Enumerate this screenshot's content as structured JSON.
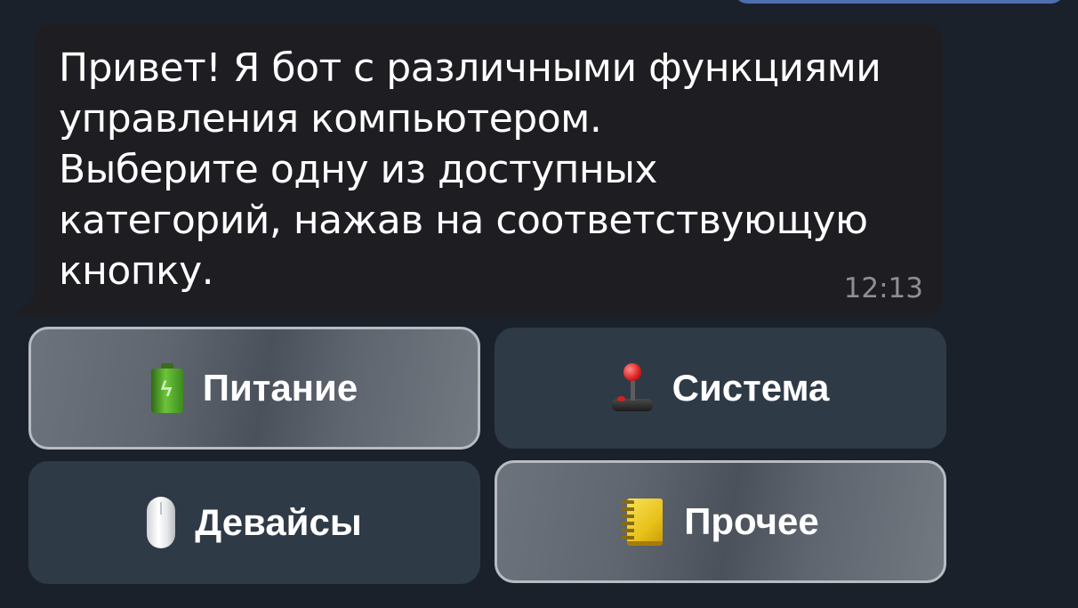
{
  "message": {
    "text": "Привет! Я бот с различными функциями\nуправления компьютером.\nВыберите одну из доступных\nкатегорий, нажав на соответствующую\nкнопку.",
    "time": "12:13"
  },
  "keyboard": {
    "buttons": [
      {
        "label": "Питание",
        "icon": "battery-icon"
      },
      {
        "label": "Система",
        "icon": "joystick-icon"
      },
      {
        "label": "Девайсы",
        "icon": "mouse-icon"
      },
      {
        "label": "Прочее",
        "icon": "notebook-icon"
      }
    ]
  },
  "colors": {
    "background": "#1a212a",
    "bubble": "#1e1e22",
    "button": "#2f3a47",
    "outgoing_bubble": "#4f6fae",
    "timestamp": "#8d8f96"
  }
}
